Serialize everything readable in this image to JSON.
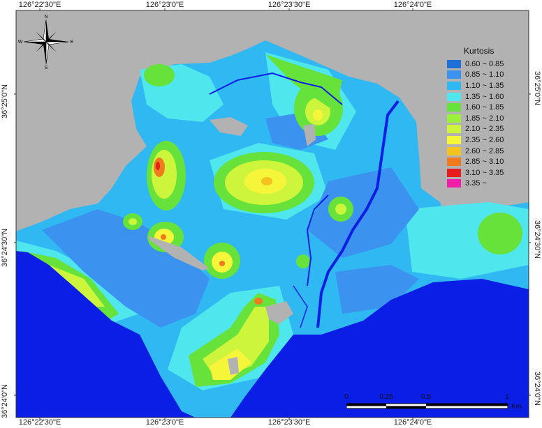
{
  "axes": {
    "top": [
      "126°22'30\"E",
      "126°23'0\"E",
      "126°23'30\"E",
      "126°24'0\"E"
    ],
    "bottom": [
      "126°22'30\"E",
      "126°23'0\"E",
      "126°23'30\"E",
      "126°24'0\"E"
    ],
    "left": [
      "36°25'0\"N",
      "36°24'30\"N",
      "36°24'0\"N"
    ],
    "right": [
      "36°25'0\"N",
      "36°24'30\"N",
      "36°24'0\"N"
    ]
  },
  "compass": {
    "n": "N",
    "s": "S",
    "e": "E",
    "w": "W"
  },
  "legend": {
    "title": "Kurtosis",
    "items": [
      {
        "label": "0.60 ~ 0.85",
        "color": "#1f6fd6"
      },
      {
        "label": "0.85 ~ 1.10",
        "color": "#3c92ef"
      },
      {
        "label": "1.10 ~ 1.35",
        "color": "#2fb8f2"
      },
      {
        "label": "1.35 ~ 1.60",
        "color": "#4fe6ee"
      },
      {
        "label": "1.60 ~ 1.85",
        "color": "#66e23a"
      },
      {
        "label": "1.85 ~ 2.10",
        "color": "#9af03a"
      },
      {
        "label": "2.10 ~ 2.35",
        "color": "#ccf53c"
      },
      {
        "label": "2.35 ~ 2.60",
        "color": "#f5f53a"
      },
      {
        "label": "2.60 ~ 2.85",
        "color": "#f5c21e"
      },
      {
        "label": "2.85 ~ 3.10",
        "color": "#f07a1e"
      },
      {
        "label": "3.10 ~ 3.35",
        "color": "#e61e1e"
      },
      {
        "label": "3.35 ~",
        "color": "#f01ea8"
      }
    ]
  },
  "scalebar": {
    "labels": [
      "0",
      "0.25",
      "0.5",
      "1"
    ],
    "unit": "Km"
  },
  "colors": {
    "land": "#b2b2b2",
    "sea": "#0a1ee6",
    "background": "#2fb8f2"
  }
}
